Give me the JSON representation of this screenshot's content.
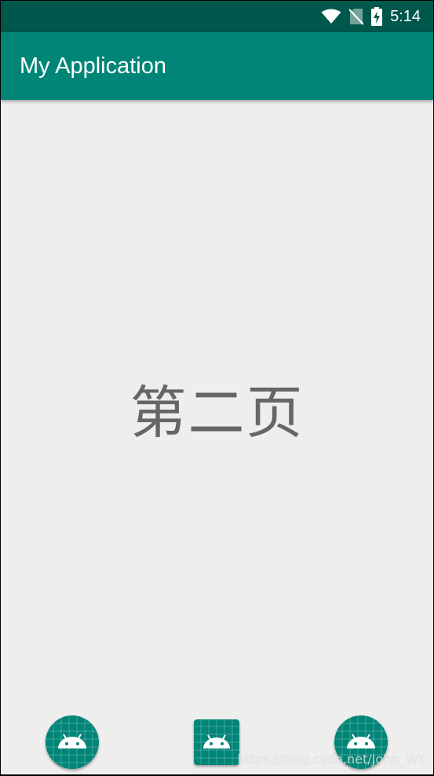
{
  "status_bar": {
    "time": "5:14",
    "icons": [
      "wifi-icon",
      "no-sim-icon",
      "battery-charging-icon"
    ]
  },
  "app_bar": {
    "title": "My Application"
  },
  "main": {
    "page_label": "第二页"
  },
  "bottom_nav": {
    "items": [
      {
        "icon": "android-launcher-round-icon"
      },
      {
        "icon": "android-launcher-square-icon"
      },
      {
        "icon": "android-launcher-round-icon"
      }
    ]
  },
  "watermark": "https://blog.csdn.net/John_WY",
  "colors": {
    "status_bar": "#00574b",
    "primary": "#008577",
    "background": "#eeeeee",
    "text": "#666666"
  }
}
